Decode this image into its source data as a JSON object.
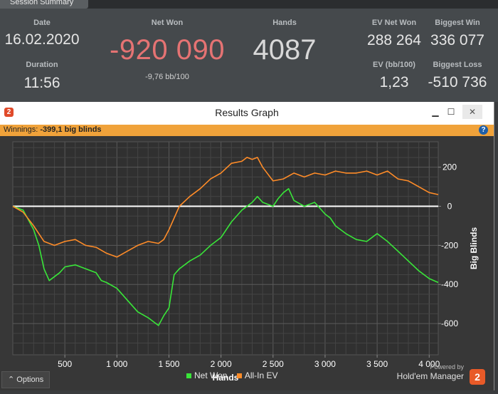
{
  "tab": {
    "label": "Session Summary"
  },
  "summary": {
    "date_label": "Date",
    "date": "16.02.2020",
    "duration_label": "Duration",
    "duration": "11:56",
    "netwon_label": "Net Won",
    "netwon": "-920 090",
    "netwon_sub": "-9,76 bb/100",
    "hands_label": "Hands",
    "hands": "4087",
    "evnet_label": "EV Net Won",
    "evnet": "288 264",
    "bigwin_label": "Biggest Win",
    "bigwin": "336 077",
    "evbb_label": "EV (bb/100)",
    "evbb": "1,23",
    "bigloss_label": "Biggest Loss",
    "bigloss": "-510 736"
  },
  "window": {
    "title": "Results Graph",
    "minimize": "▁",
    "maximize": "☐",
    "close": "✕"
  },
  "winnings": {
    "label": "Winnings:",
    "value": "-399,1 big blinds"
  },
  "options": {
    "label": "Options"
  },
  "powered": {
    "line1": "Powered by",
    "line2": "Hold'em Manager",
    "logo": "2"
  },
  "colors": {
    "net_won": "#39e639",
    "all_in_ev": "#ff8c28",
    "zero_line": "#ffffff",
    "net_won_header": "#e57373"
  },
  "chart_data": {
    "type": "line",
    "xlabel": "Hands",
    "ylabel": "Big Blinds",
    "xlim": [
      0,
      4087
    ],
    "ylim": [
      -760,
      330
    ],
    "xticks": [
      500,
      1000,
      1500,
      2000,
      2500,
      3000,
      3500,
      4000
    ],
    "xtick_labels": [
      "500",
      "1 000",
      "1 500",
      "2 000",
      "2 500",
      "3 000",
      "3 500",
      "4 000"
    ],
    "yticks": [
      200,
      0,
      -200,
      -400,
      -600
    ],
    "ytick_labels": [
      "200",
      "0",
      "-200",
      "-400",
      "-600"
    ],
    "legend": "bottom-center",
    "grid": true,
    "series": [
      {
        "name": "Net Won",
        "x": [
          0,
          100,
          200,
          250,
          300,
          350,
          400,
          450,
          500,
          600,
          700,
          800,
          850,
          900,
          1000,
          1100,
          1200,
          1300,
          1350,
          1400,
          1450,
          1500,
          1550,
          1600,
          1700,
          1800,
          1900,
          2000,
          2050,
          2100,
          2200,
          2300,
          2350,
          2400,
          2500,
          2550,
          2600,
          2650,
          2700,
          2800,
          2900,
          3000,
          3050,
          3100,
          3200,
          3300,
          3400,
          3450,
          3500,
          3600,
          3700,
          3800,
          3900,
          4000,
          4087
        ],
        "y": [
          0,
          -20,
          -120,
          -200,
          -320,
          -380,
          -360,
          -340,
          -310,
          -300,
          -320,
          -340,
          -380,
          -390,
          -420,
          -480,
          -540,
          -570,
          -590,
          -610,
          -560,
          -520,
          -350,
          -320,
          -280,
          -250,
          -200,
          -160,
          -120,
          -80,
          -20,
          20,
          50,
          20,
          0,
          40,
          70,
          90,
          30,
          0,
          20,
          -40,
          -60,
          -100,
          -140,
          -170,
          -180,
          -160,
          -140,
          -180,
          -230,
          -280,
          -330,
          -370,
          -390
        ]
      },
      {
        "name": "All-In EV",
        "x": [
          0,
          100,
          200,
          250,
          300,
          400,
          500,
          600,
          700,
          800,
          900,
          1000,
          1100,
          1200,
          1300,
          1400,
          1450,
          1500,
          1550,
          1600,
          1700,
          1800,
          1900,
          2000,
          2100,
          2200,
          2250,
          2300,
          2350,
          2400,
          2500,
          2600,
          2700,
          2800,
          2900,
          3000,
          3100,
          3200,
          3300,
          3400,
          3500,
          3600,
          3700,
          3800,
          3900,
          4000,
          4087
        ],
        "y": [
          0,
          -30,
          -100,
          -140,
          -180,
          -200,
          -180,
          -170,
          -200,
          -210,
          -240,
          -260,
          -230,
          -200,
          -180,
          -190,
          -170,
          -120,
          -60,
          0,
          50,
          90,
          140,
          170,
          220,
          230,
          250,
          240,
          250,
          200,
          130,
          140,
          170,
          150,
          170,
          160,
          180,
          170,
          170,
          180,
          160,
          180,
          140,
          130,
          100,
          70,
          60
        ]
      }
    ]
  }
}
